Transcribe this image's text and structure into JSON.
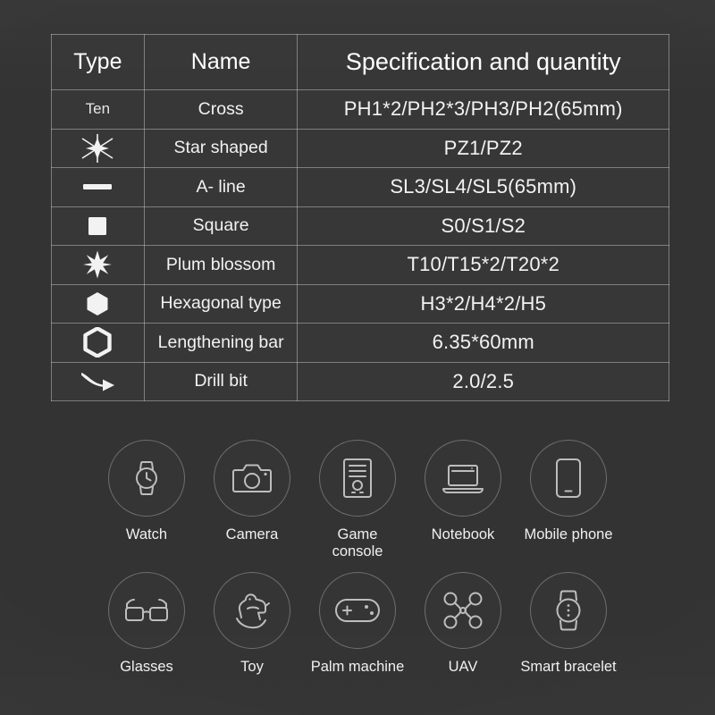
{
  "background_color": "#333333",
  "spec_table": {
    "headers": [
      "Type",
      "Name",
      "Specification and quantity"
    ],
    "rows": [
      {
        "type_icon": "text-ten",
        "type_text": "Ten",
        "name": "Cross",
        "spec": "PH1*2/PH2*3/PH3/PH2(65mm)"
      },
      {
        "type_icon": "six-point-star-icon",
        "type_text": "",
        "name": "Star shaped",
        "spec": "PZ1/PZ2"
      },
      {
        "type_icon": "dash-bar-icon",
        "type_text": "",
        "name": "A- line",
        "spec": "SL3/SL4/SL5(65mm)"
      },
      {
        "type_icon": "filled-square-icon",
        "type_text": "",
        "name": "Square",
        "spec": "S0/S1/S2"
      },
      {
        "type_icon": "torx-star-icon",
        "type_text": "",
        "name": "Plum blossom",
        "spec": "T10/T15*2/T20*2"
      },
      {
        "type_icon": "filled-hexagon-icon",
        "type_text": "",
        "name": "Hexagonal type",
        "spec": "H3*2/H4*2/H5"
      },
      {
        "type_icon": "hollow-hexagon-icon",
        "type_text": "",
        "name": "Lengthening bar",
        "spec": "6.35*60mm"
      },
      {
        "type_icon": "drill-bit-icon",
        "type_text": "",
        "name": "Drill bit",
        "spec": "2.0/2.5"
      }
    ]
  },
  "icon_grid": {
    "row1": [
      {
        "icon": "watch-icon",
        "label": "Watch"
      },
      {
        "icon": "camera-icon",
        "label": "Camera"
      },
      {
        "icon": "desktop-tower-icon",
        "label": "Game\nconsole"
      },
      {
        "icon": "laptop-icon",
        "label": "Notebook"
      },
      {
        "icon": "smartphone-icon",
        "label": "Mobile phone"
      }
    ],
    "row2": [
      {
        "icon": "glasses-icon",
        "label": "Glasses"
      },
      {
        "icon": "rocking-horse-icon",
        "label": "Toy"
      },
      {
        "icon": "gamepad-icon",
        "label": "Palm machine"
      },
      {
        "icon": "drone-icon",
        "label": "UAV"
      },
      {
        "icon": "smart-bracelet-icon",
        "label": "Smart bracelet"
      }
    ]
  }
}
